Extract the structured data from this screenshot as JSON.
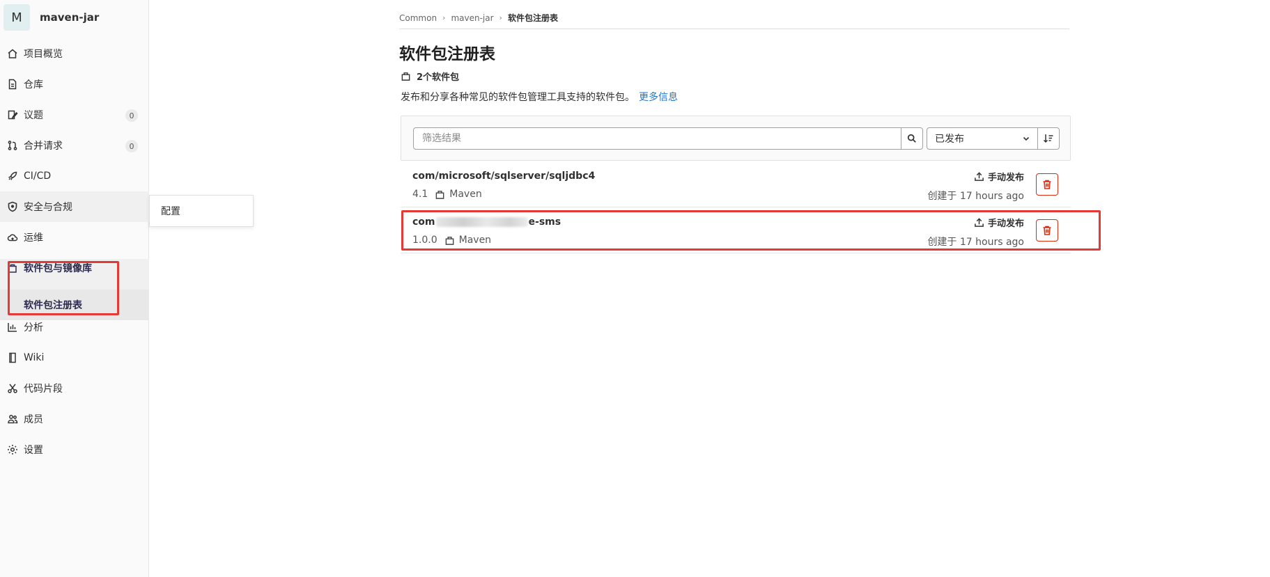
{
  "project": {
    "avatar_letter": "M",
    "name": "maven-jar"
  },
  "sidebar": {
    "items": [
      {
        "label": "项目概览",
        "icon": "home-icon"
      },
      {
        "label": "仓库",
        "icon": "document-icon"
      },
      {
        "label": "议题",
        "icon": "issues-icon",
        "count": "0"
      },
      {
        "label": "合并请求",
        "icon": "merge-request-icon",
        "count": "0"
      },
      {
        "label": "CI/CD",
        "icon": "rocket-icon"
      },
      {
        "label": "安全与合规",
        "icon": "shield-icon"
      },
      {
        "label": "运维",
        "icon": "cloud-icon"
      },
      {
        "label": "软件包与镜像库",
        "icon": "package-icon"
      },
      {
        "label": "分析",
        "icon": "chart-icon"
      },
      {
        "label": "Wiki",
        "icon": "book-icon"
      },
      {
        "label": "代码片段",
        "icon": "scissors-icon"
      },
      {
        "label": "成员",
        "icon": "users-icon"
      },
      {
        "label": "设置",
        "icon": "gear-icon"
      }
    ],
    "sub_item": "软件包注册表",
    "flyout_label": "配置"
  },
  "breadcrumb": {
    "items": [
      "Common",
      "maven-jar"
    ],
    "current": "软件包注册表"
  },
  "page": {
    "title": "软件包注册表",
    "count_text": "2个软件包",
    "description": "发布和分享各种常见的软件包管理工具支持的软件包。",
    "more_info": "更多信息"
  },
  "filter": {
    "placeholder": "筛选结果",
    "status": "已发布"
  },
  "packages": [
    {
      "name": "com/microsoft/sqlserver/sqljdbc4",
      "version": "4.1",
      "type": "Maven",
      "publish": "手动发布",
      "created": "创建于 17 hours ago"
    },
    {
      "name_prefix": "com",
      "name_suffix": "e-sms",
      "version": "1.0.0",
      "type": "Maven",
      "publish": "手动发布",
      "created": "创建于 17 hours ago"
    }
  ],
  "colors": {
    "accent_link": "#1f75cb",
    "danger": "#dd2b0e",
    "highlight_box": "#e53935"
  }
}
